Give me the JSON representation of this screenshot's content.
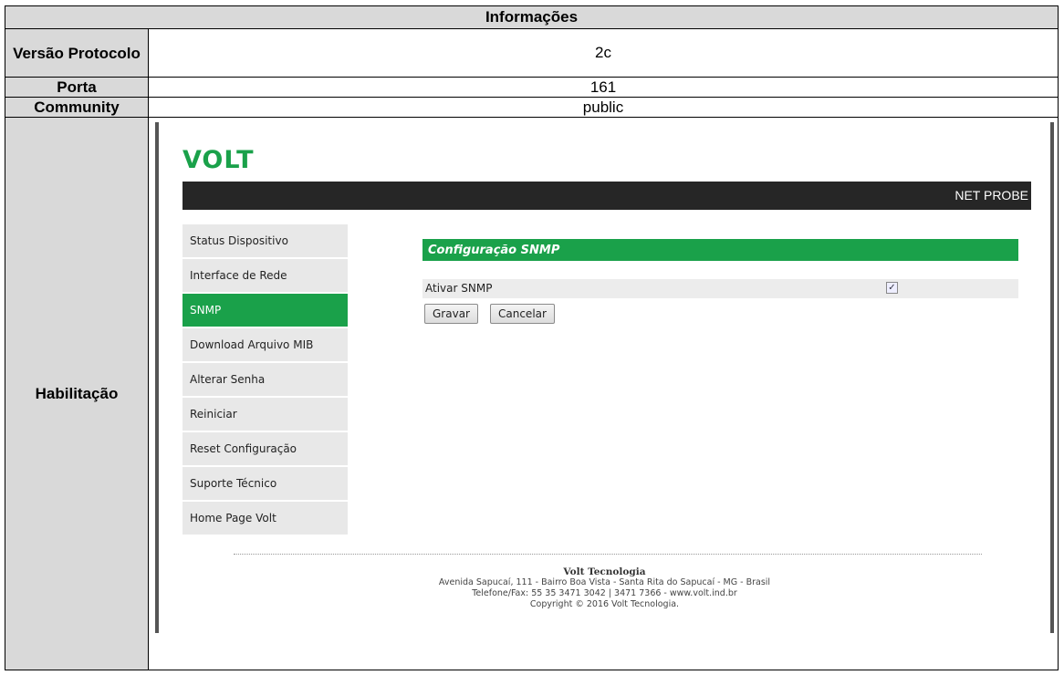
{
  "table": {
    "header": "Informações",
    "rows": [
      {
        "label": "Versão Protocolo",
        "value": "2c"
      },
      {
        "label": "Porta",
        "value": "161"
      },
      {
        "label": "Community",
        "value": "public"
      },
      {
        "label": "Habilitação"
      }
    ]
  },
  "screenshot": {
    "logo_text": "VOLT",
    "banner_title": "NET PROBE",
    "menu": [
      {
        "label": "Status Dispositivo",
        "active": false
      },
      {
        "label": "Interface de Rede",
        "active": false
      },
      {
        "label": "SNMP",
        "active": true
      },
      {
        "label": "Download Arquivo MIB",
        "active": false
      },
      {
        "label": "Alterar Senha",
        "active": false
      },
      {
        "label": "Reiniciar",
        "active": false
      },
      {
        "label": "Reset Configuração",
        "active": false
      },
      {
        "label": "Suporte Técnico",
        "active": false
      },
      {
        "label": "Home Page Volt",
        "active": false
      }
    ],
    "panel_title": "Configuração SNMP",
    "snmp_enable_label": "Ativar SNMP",
    "snmp_enabled": true,
    "save_label": "Gravar",
    "cancel_label": "Cancelar",
    "footer": {
      "company": "Volt Tecnologia",
      "address": "Avenida Sapucaí, 111 - Bairro Boa Vista - Santa Rita do Sapucaí - MG - Brasil",
      "phone": "Telefone/Fax: 55 35 3471 3042 | 3471 7366 - www.volt.ind.br",
      "copyright": "Copyright © 2016 Volt Tecnologia."
    },
    "colors": {
      "brand_green": "#1aa14a",
      "banner": "#262626"
    }
  }
}
